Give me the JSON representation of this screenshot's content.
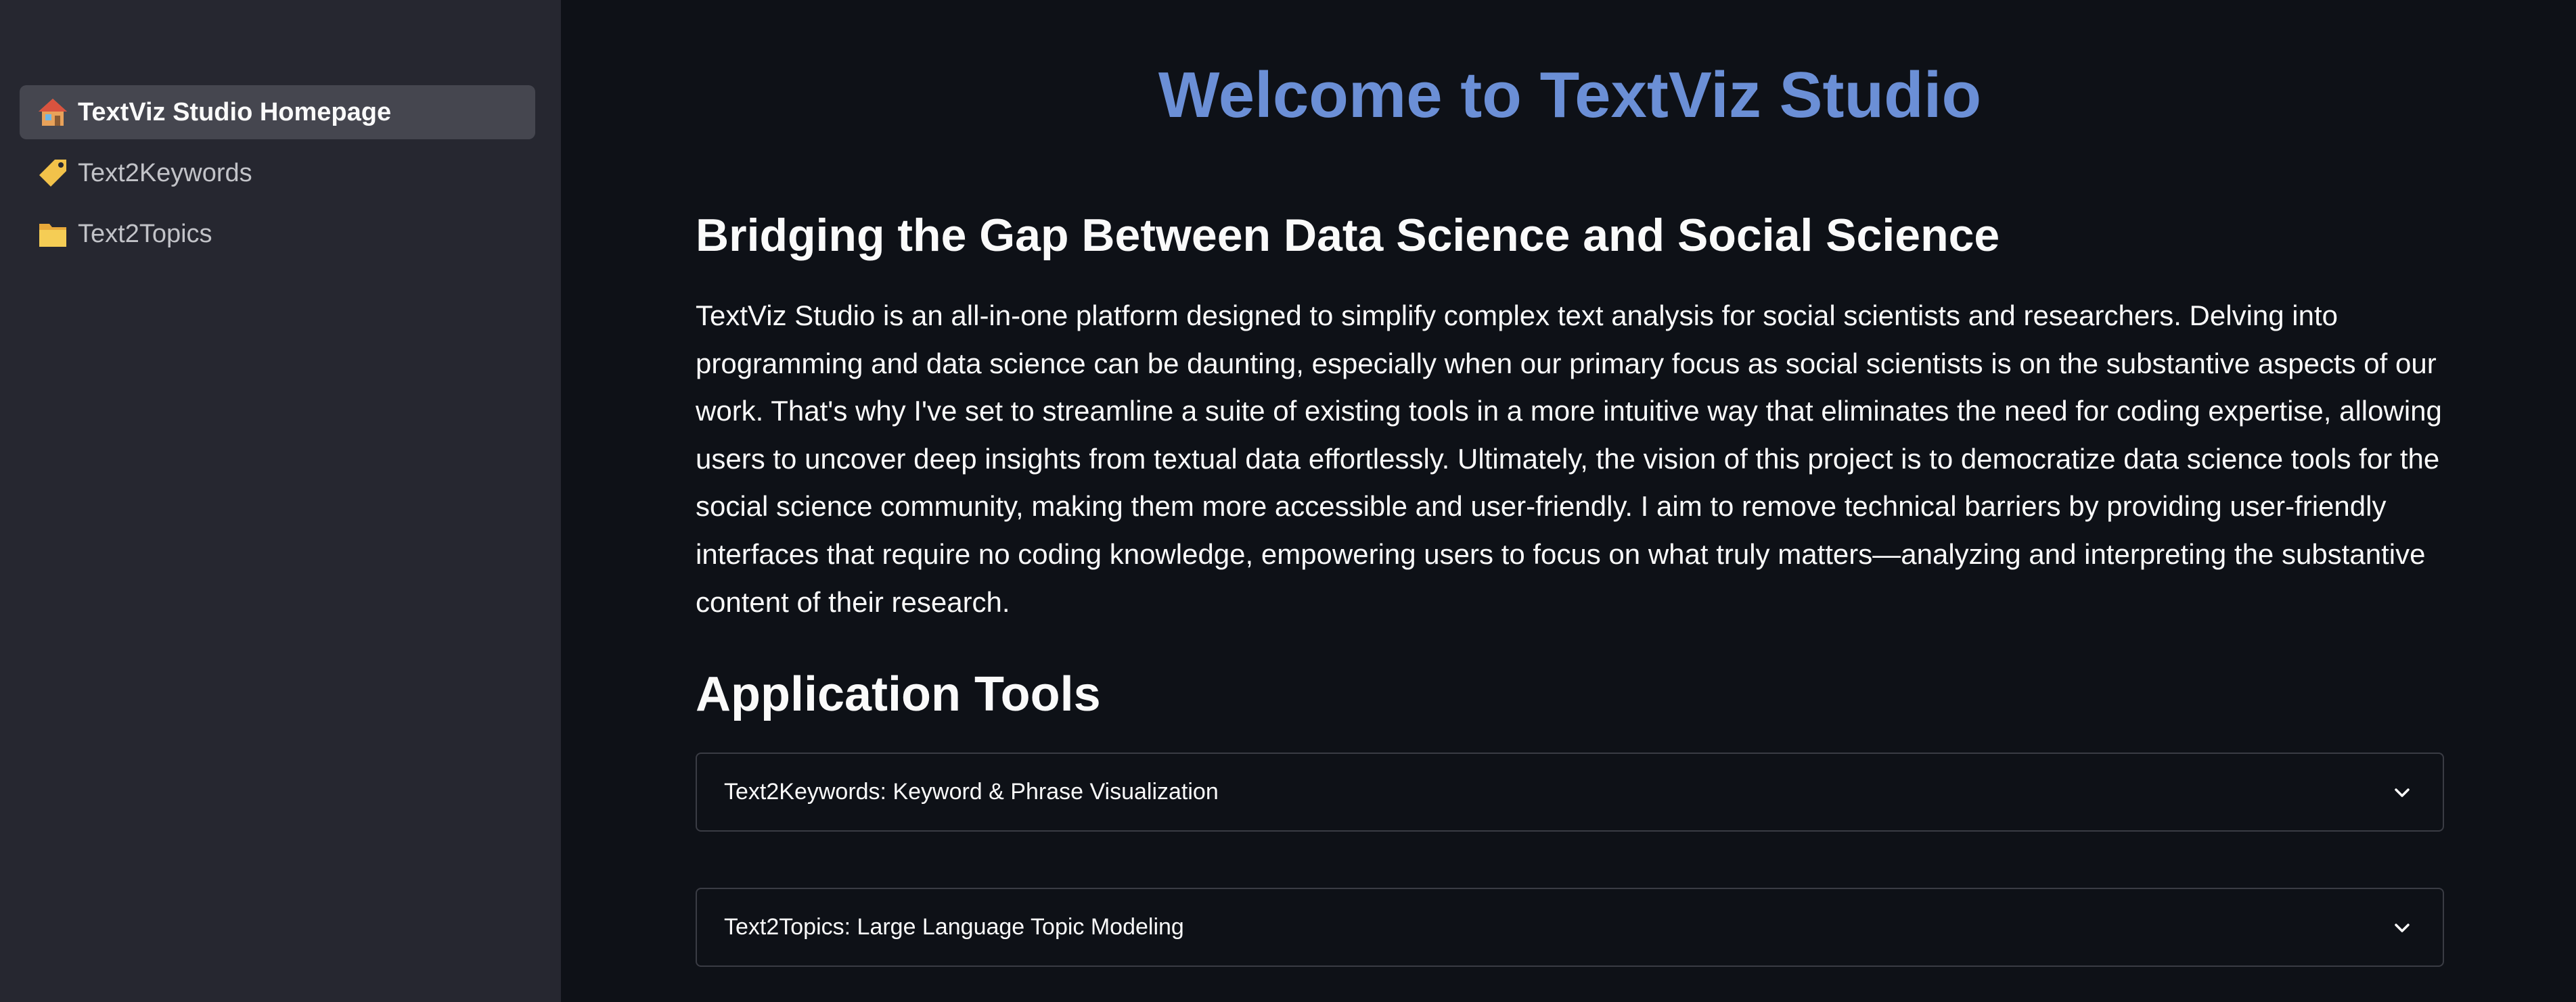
{
  "sidebar": {
    "items": [
      {
        "label": "TextViz Studio Homepage",
        "icon": "house-icon",
        "active": true
      },
      {
        "label": "Text2Keywords",
        "icon": "label-tag-icon",
        "active": false
      },
      {
        "label": "Text2Topics",
        "icon": "folder-icon",
        "active": false
      }
    ]
  },
  "main": {
    "title": "Welcome to TextViz Studio",
    "section_heading": "Bridging the Gap Between Data Science and Social Science",
    "intro": "TextViz Studio is an all-in-one platform designed to simplify complex text analysis for social scientists and researchers. Delving into programming and data science can be daunting, especially when our primary focus as social scientists is on the substantive aspects of our work. That's why I've set to streamline a suite of existing tools in a more intuitive way that eliminates the need for coding expertise, allowing users to uncover deep insights from textual data effortlessly. Ultimately, the vision of this project is to democratize data science tools for the social science community, making them more accessible and user-friendly. I aim to remove technical barriers by providing user-friendly interfaces that require no coding knowledge, empowering users to focus on what truly matters—analyzing and interpreting the substantive content of their research.",
    "tools_heading": "Application Tools",
    "expanders": [
      {
        "label": "Text2Keywords: Keyword & Phrase Visualization",
        "icon": "chevron-down-icon"
      },
      {
        "label": "Text2Topics: Large Language Topic Modeling",
        "icon": "chevron-down-icon"
      }
    ]
  },
  "colors": {
    "background": "#0e1117",
    "sidebar": "#262730",
    "title_accent": "#6b8fd6",
    "active_nav": "#45464f"
  }
}
